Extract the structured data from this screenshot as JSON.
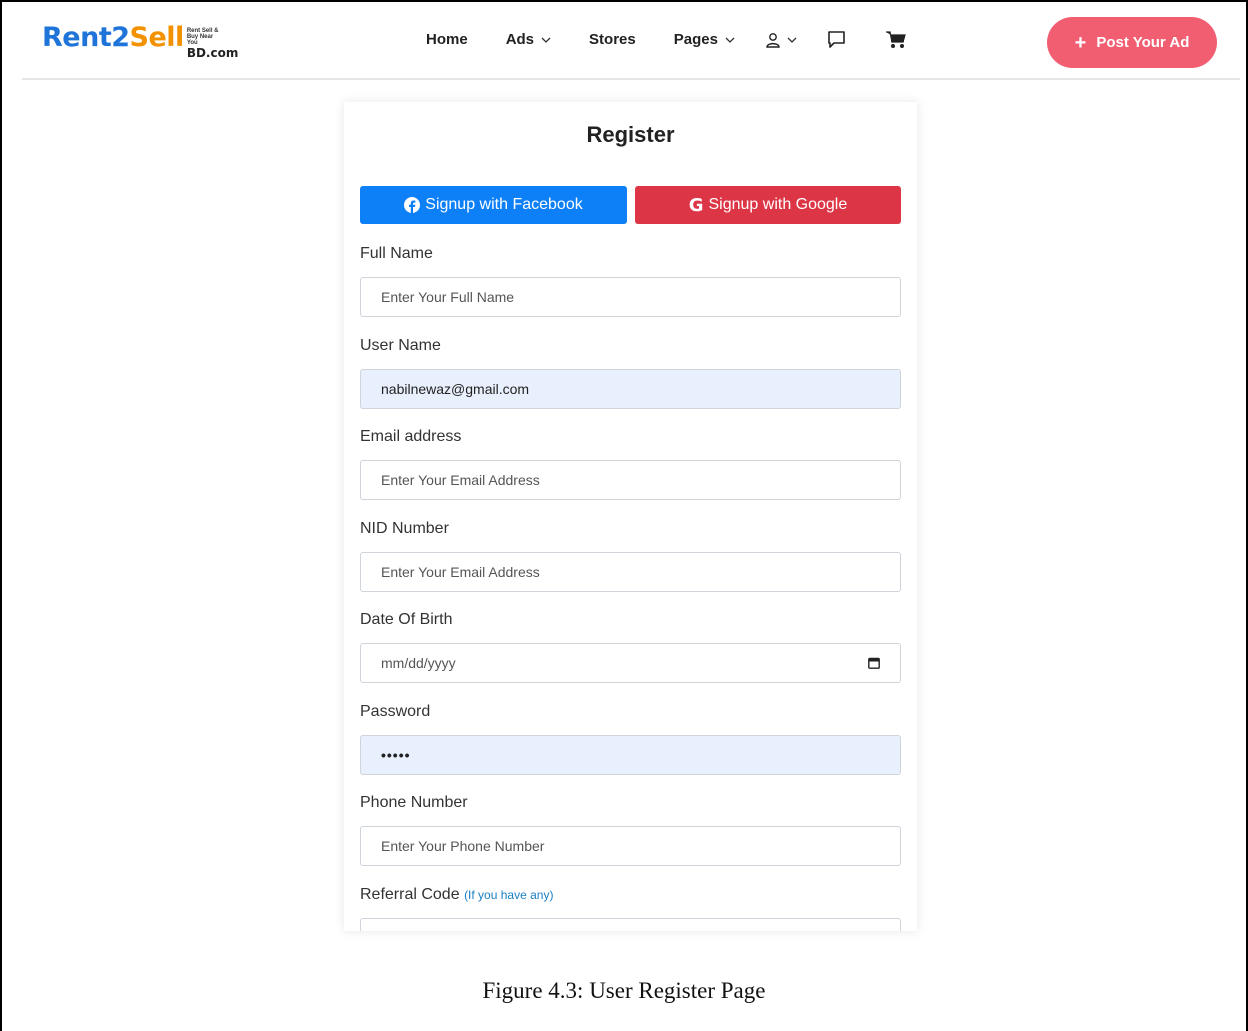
{
  "header": {
    "logo": {
      "part1": "Rent2",
      "part2": "Sell",
      "tagline": "Rent Sell & Buy Near You",
      "domain": "BD.com"
    },
    "nav": {
      "home": "Home",
      "ads": "Ads",
      "stores": "Stores",
      "pages": "Pages"
    },
    "icons": [
      "user-icon",
      "chat-icon",
      "cart-icon",
      "chevron-down-icon",
      "plus-icon"
    ],
    "post_ad": "Post Your Ad"
  },
  "form": {
    "title": "Register",
    "facebook_label": "Signup with Facebook",
    "google_label": "Signup with Google",
    "full_name": {
      "label": "Full Name",
      "placeholder": "Enter Your Full Name"
    },
    "user_name": {
      "label": "User Name",
      "value": "nabilnewaz@gmail.com"
    },
    "email": {
      "label": "Email address",
      "placeholder": "Enter Your Email Address"
    },
    "nid": {
      "label": "NID Number",
      "placeholder": "Enter Your Email Address"
    },
    "dob": {
      "label": "Date Of Birth",
      "placeholder": "mm/dd/yyyy"
    },
    "password": {
      "label": "Password",
      "value": "•••••"
    },
    "phone": {
      "label": "Phone Number",
      "placeholder": "Enter Your Phone Number"
    },
    "referral": {
      "label": "Referral Code",
      "hint": "(If you have any)"
    }
  },
  "colors": {
    "facebook": "#0d7ff7",
    "google": "#dc3545",
    "post_ad": "#f15e72",
    "autofill": "#e8f0fe"
  },
  "caption": "Figure 4.3: User Register Page"
}
